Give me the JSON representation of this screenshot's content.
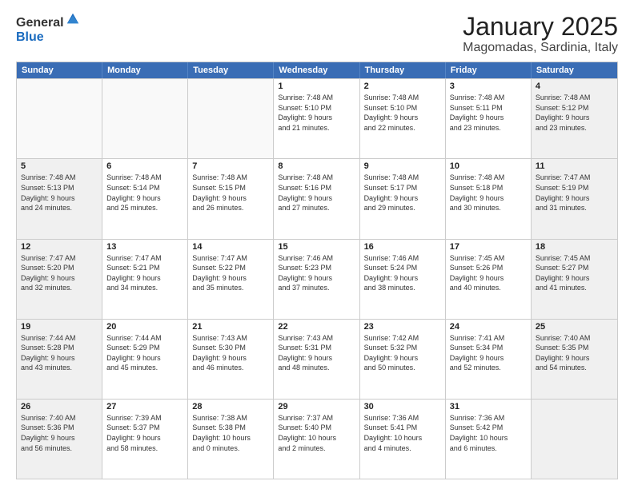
{
  "logo": {
    "general": "General",
    "blue": "Blue"
  },
  "title": "January 2025",
  "subtitle": "Magomadas, Sardinia, Italy",
  "header_days": [
    "Sunday",
    "Monday",
    "Tuesday",
    "Wednesday",
    "Thursday",
    "Friday",
    "Saturday"
  ],
  "weeks": [
    [
      {
        "day": "",
        "info": "",
        "shaded": false,
        "empty": true
      },
      {
        "day": "",
        "info": "",
        "shaded": false,
        "empty": true
      },
      {
        "day": "",
        "info": "",
        "shaded": false,
        "empty": true
      },
      {
        "day": "1",
        "info": "Sunrise: 7:48 AM\nSunset: 5:10 PM\nDaylight: 9 hours\nand 21 minutes.",
        "shaded": false,
        "empty": false
      },
      {
        "day": "2",
        "info": "Sunrise: 7:48 AM\nSunset: 5:10 PM\nDaylight: 9 hours\nand 22 minutes.",
        "shaded": false,
        "empty": false
      },
      {
        "day": "3",
        "info": "Sunrise: 7:48 AM\nSunset: 5:11 PM\nDaylight: 9 hours\nand 23 minutes.",
        "shaded": false,
        "empty": false
      },
      {
        "day": "4",
        "info": "Sunrise: 7:48 AM\nSunset: 5:12 PM\nDaylight: 9 hours\nand 23 minutes.",
        "shaded": true,
        "empty": false
      }
    ],
    [
      {
        "day": "5",
        "info": "Sunrise: 7:48 AM\nSunset: 5:13 PM\nDaylight: 9 hours\nand 24 minutes.",
        "shaded": true,
        "empty": false
      },
      {
        "day": "6",
        "info": "Sunrise: 7:48 AM\nSunset: 5:14 PM\nDaylight: 9 hours\nand 25 minutes.",
        "shaded": false,
        "empty": false
      },
      {
        "day": "7",
        "info": "Sunrise: 7:48 AM\nSunset: 5:15 PM\nDaylight: 9 hours\nand 26 minutes.",
        "shaded": false,
        "empty": false
      },
      {
        "day": "8",
        "info": "Sunrise: 7:48 AM\nSunset: 5:16 PM\nDaylight: 9 hours\nand 27 minutes.",
        "shaded": false,
        "empty": false
      },
      {
        "day": "9",
        "info": "Sunrise: 7:48 AM\nSunset: 5:17 PM\nDaylight: 9 hours\nand 29 minutes.",
        "shaded": false,
        "empty": false
      },
      {
        "day": "10",
        "info": "Sunrise: 7:48 AM\nSunset: 5:18 PM\nDaylight: 9 hours\nand 30 minutes.",
        "shaded": false,
        "empty": false
      },
      {
        "day": "11",
        "info": "Sunrise: 7:47 AM\nSunset: 5:19 PM\nDaylight: 9 hours\nand 31 minutes.",
        "shaded": true,
        "empty": false
      }
    ],
    [
      {
        "day": "12",
        "info": "Sunrise: 7:47 AM\nSunset: 5:20 PM\nDaylight: 9 hours\nand 32 minutes.",
        "shaded": true,
        "empty": false
      },
      {
        "day": "13",
        "info": "Sunrise: 7:47 AM\nSunset: 5:21 PM\nDaylight: 9 hours\nand 34 minutes.",
        "shaded": false,
        "empty": false
      },
      {
        "day": "14",
        "info": "Sunrise: 7:47 AM\nSunset: 5:22 PM\nDaylight: 9 hours\nand 35 minutes.",
        "shaded": false,
        "empty": false
      },
      {
        "day": "15",
        "info": "Sunrise: 7:46 AM\nSunset: 5:23 PM\nDaylight: 9 hours\nand 37 minutes.",
        "shaded": false,
        "empty": false
      },
      {
        "day": "16",
        "info": "Sunrise: 7:46 AM\nSunset: 5:24 PM\nDaylight: 9 hours\nand 38 minutes.",
        "shaded": false,
        "empty": false
      },
      {
        "day": "17",
        "info": "Sunrise: 7:45 AM\nSunset: 5:26 PM\nDaylight: 9 hours\nand 40 minutes.",
        "shaded": false,
        "empty": false
      },
      {
        "day": "18",
        "info": "Sunrise: 7:45 AM\nSunset: 5:27 PM\nDaylight: 9 hours\nand 41 minutes.",
        "shaded": true,
        "empty": false
      }
    ],
    [
      {
        "day": "19",
        "info": "Sunrise: 7:44 AM\nSunset: 5:28 PM\nDaylight: 9 hours\nand 43 minutes.",
        "shaded": true,
        "empty": false
      },
      {
        "day": "20",
        "info": "Sunrise: 7:44 AM\nSunset: 5:29 PM\nDaylight: 9 hours\nand 45 minutes.",
        "shaded": false,
        "empty": false
      },
      {
        "day": "21",
        "info": "Sunrise: 7:43 AM\nSunset: 5:30 PM\nDaylight: 9 hours\nand 46 minutes.",
        "shaded": false,
        "empty": false
      },
      {
        "day": "22",
        "info": "Sunrise: 7:43 AM\nSunset: 5:31 PM\nDaylight: 9 hours\nand 48 minutes.",
        "shaded": false,
        "empty": false
      },
      {
        "day": "23",
        "info": "Sunrise: 7:42 AM\nSunset: 5:32 PM\nDaylight: 9 hours\nand 50 minutes.",
        "shaded": false,
        "empty": false
      },
      {
        "day": "24",
        "info": "Sunrise: 7:41 AM\nSunset: 5:34 PM\nDaylight: 9 hours\nand 52 minutes.",
        "shaded": false,
        "empty": false
      },
      {
        "day": "25",
        "info": "Sunrise: 7:40 AM\nSunset: 5:35 PM\nDaylight: 9 hours\nand 54 minutes.",
        "shaded": true,
        "empty": false
      }
    ],
    [
      {
        "day": "26",
        "info": "Sunrise: 7:40 AM\nSunset: 5:36 PM\nDaylight: 9 hours\nand 56 minutes.",
        "shaded": true,
        "empty": false
      },
      {
        "day": "27",
        "info": "Sunrise: 7:39 AM\nSunset: 5:37 PM\nDaylight: 9 hours\nand 58 minutes.",
        "shaded": false,
        "empty": false
      },
      {
        "day": "28",
        "info": "Sunrise: 7:38 AM\nSunset: 5:38 PM\nDaylight: 10 hours\nand 0 minutes.",
        "shaded": false,
        "empty": false
      },
      {
        "day": "29",
        "info": "Sunrise: 7:37 AM\nSunset: 5:40 PM\nDaylight: 10 hours\nand 2 minutes.",
        "shaded": false,
        "empty": false
      },
      {
        "day": "30",
        "info": "Sunrise: 7:36 AM\nSunset: 5:41 PM\nDaylight: 10 hours\nand 4 minutes.",
        "shaded": false,
        "empty": false
      },
      {
        "day": "31",
        "info": "Sunrise: 7:36 AM\nSunset: 5:42 PM\nDaylight: 10 hours\nand 6 minutes.",
        "shaded": false,
        "empty": false
      },
      {
        "day": "",
        "info": "",
        "shaded": true,
        "empty": true
      }
    ]
  ]
}
